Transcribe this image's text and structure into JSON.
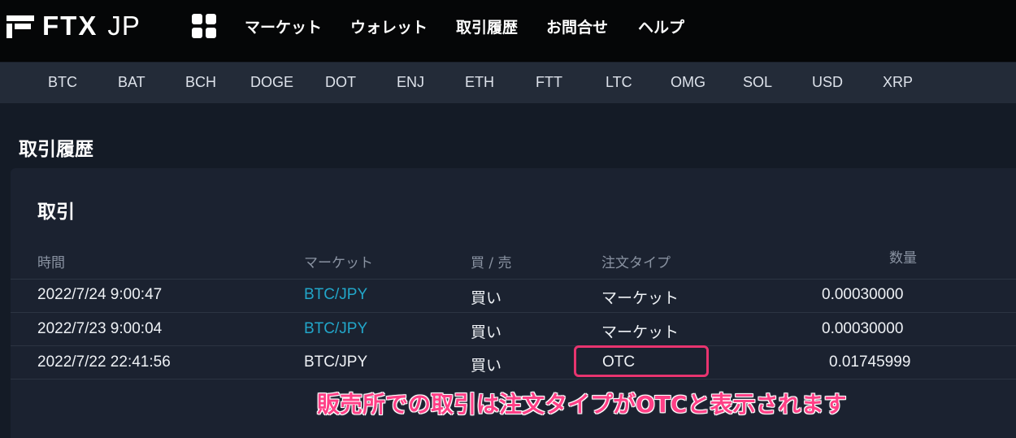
{
  "brand": {
    "name": "FTX",
    "region": "JP"
  },
  "icons": {
    "logo": "ftx-logo-mark",
    "apps": "apps-grid-icon"
  },
  "nav": {
    "items": [
      "マーケット",
      "ウォレット",
      "取引履歴",
      "お問合せ",
      "ヘルプ"
    ]
  },
  "currencies": [
    "BTC",
    "BAT",
    "BCH",
    "DOGE",
    "DOT",
    "ENJ",
    "ETH",
    "FTT",
    "LTC",
    "OMG",
    "SOL",
    "USD",
    "XRP"
  ],
  "page": {
    "title": "取引履歴"
  },
  "trades": {
    "title": "取引",
    "columns": {
      "time": "時間",
      "market": "マーケット",
      "side": "買 / 売",
      "order_type": "注文タイプ",
      "quantity": "数量"
    },
    "rows": [
      {
        "time": "2022/7/24 9:00:47",
        "market": "BTC/JPY",
        "side": "買い",
        "order_type": "マーケット",
        "quantity": "0.00030000"
      },
      {
        "time": "2022/7/23 9:00:04",
        "market": "BTC/JPY",
        "side": "買い",
        "order_type": "マーケット",
        "quantity": "0.00030000"
      },
      {
        "time": "2022/7/22 22:41:56",
        "market": "BTC/JPY",
        "side": "買い",
        "order_type": "OTC",
        "quantity": "0.01745999"
      }
    ]
  },
  "annotation": {
    "text": "販売所での取引は注文タイプがOTCと表示されます",
    "color": "#ff3f86",
    "highlight_color": "#e8346f"
  },
  "colors": {
    "topbar": "#050607",
    "currency_bar": "#232b38",
    "background": "#141b26",
    "panel": "#1b2230",
    "link": "#22a6c9"
  }
}
